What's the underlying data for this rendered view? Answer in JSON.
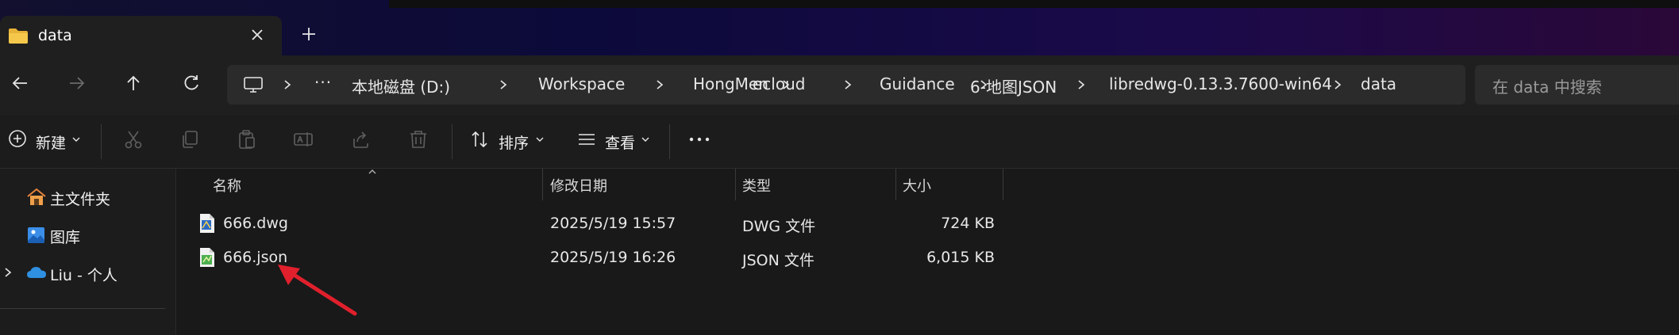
{
  "window": {
    "tab_title": "data",
    "colors": {
      "titlebar_gradient_start": "#12102e",
      "titlebar_gradient_end": "#2a0838",
      "background": "#191919",
      "arrow": "#e0202c"
    }
  },
  "breadcrumb": {
    "more": "···",
    "items": [
      "本地磁盘 (D:)",
      "Workspace",
      "HongMen",
      "ecloud",
      "Guidance",
      "6-地图JSON",
      "libredwg-0.13.3.7600-win64",
      "data"
    ]
  },
  "search": {
    "placeholder": "在 data 中搜索"
  },
  "toolbar": {
    "new_label": "新建",
    "sort_label": "排序",
    "view_label": "查看"
  },
  "sidebar": {
    "items": [
      {
        "label": "主文件夹",
        "icon": "home-icon"
      },
      {
        "label": "图库",
        "icon": "gallery-icon"
      },
      {
        "label": "Liu - 个人",
        "icon": "onedrive-icon"
      }
    ]
  },
  "filelist": {
    "columns": {
      "name": "名称",
      "modified": "修改日期",
      "type": "类型",
      "size": "大小"
    },
    "rows": [
      {
        "name": "666.dwg",
        "modified": "2025/5/19 15:57",
        "type": "DWG 文件",
        "size": "724 KB",
        "icon": "dwg-file-icon"
      },
      {
        "name": "666.json",
        "modified": "2025/5/19 16:26",
        "type": "JSON 文件",
        "size": "6,015 KB",
        "icon": "json-file-icon"
      }
    ]
  }
}
